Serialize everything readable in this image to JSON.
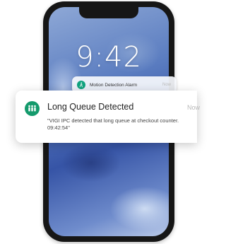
{
  "lock_screen": {
    "time": "9:42"
  },
  "small_notification": {
    "app_icon": "person-walking-icon",
    "title": "Motion Detection Alarm",
    "time": "Now"
  },
  "big_notification": {
    "app_icon": "group-people-icon",
    "title": "Long Queue Detected",
    "time": "Now",
    "body": "\"VIGI IPC detected that long queue at checkout counter. 09:42:54\""
  },
  "colors": {
    "app_green": "#149a6c",
    "phone_frame": "#161616"
  }
}
